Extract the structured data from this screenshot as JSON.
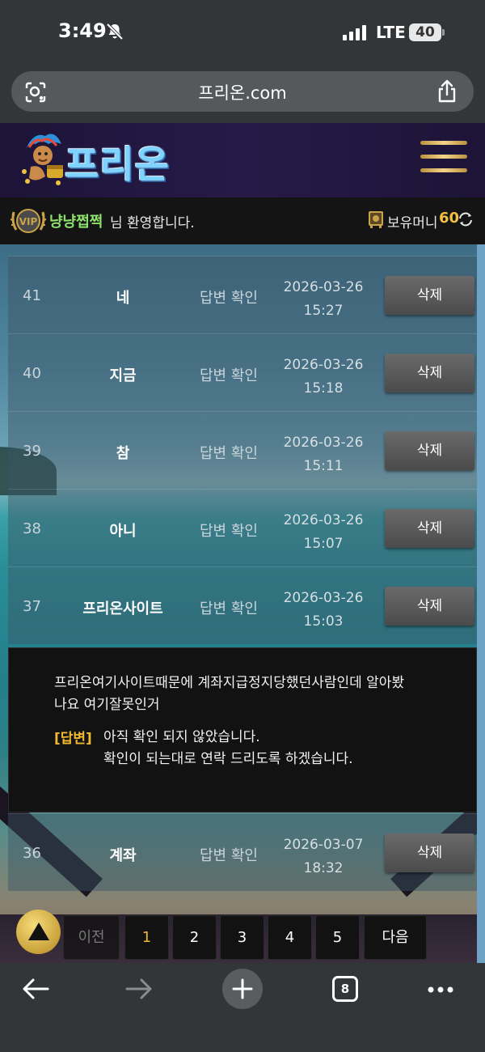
{
  "status_bar": {
    "time": "3:49",
    "network": "LTE",
    "battery": "40"
  },
  "browser": {
    "url": "프리온.com",
    "open_tabs": "8"
  },
  "site": {
    "logo_text": "프리온",
    "user_name": "냥냥쩝쩍",
    "welcome_suffix": "님 환영합니다.",
    "money_label": "보유머니",
    "money_value": "60"
  },
  "rows": [
    {
      "num": "41",
      "subject": "네",
      "status": "답변 확인",
      "date": "2026-03-26",
      "time": "15:27",
      "action": "삭제"
    },
    {
      "num": "40",
      "subject": "지금",
      "status": "답변 확인",
      "date": "2026-03-26",
      "time": "15:18",
      "action": "삭제"
    },
    {
      "num": "39",
      "subject": "참",
      "status": "답변 확인",
      "date": "2026-03-26",
      "time": "15:11",
      "action": "삭제"
    },
    {
      "num": "38",
      "subject": "아니",
      "status": "답변 확인",
      "date": "2026-03-26",
      "time": "15:07",
      "action": "삭제"
    },
    {
      "num": "37",
      "subject": "프리온사이트",
      "status": "답변 확인",
      "date": "2026-03-26",
      "time": "15:03",
      "action": "삭제"
    },
    {
      "num": "36",
      "subject": "계좌",
      "status": "답변 확인",
      "date": "2026-03-07",
      "time": "18:32",
      "action": "삭제"
    }
  ],
  "answer_panel": {
    "question_line1": "프리온여기사이트때문에 계좌지급정지당했던사람인데 알아봤",
    "question_line2": "나요 여기잘못인거",
    "answer_tag": "[답변]",
    "answer_line1": "아직 확인 되지 않았습니다.",
    "answer_line2": "확인이 되는대로 연락 드리도록 하겠습니다."
  },
  "pagination": {
    "prev": "이전",
    "pages": [
      "1",
      "2",
      "3",
      "4",
      "5"
    ],
    "next": "다음",
    "current": "1"
  },
  "colors": {
    "accent_gold": "#f0b830",
    "user_green": "#8de16c",
    "logo_blue": "#7fd4ff"
  }
}
